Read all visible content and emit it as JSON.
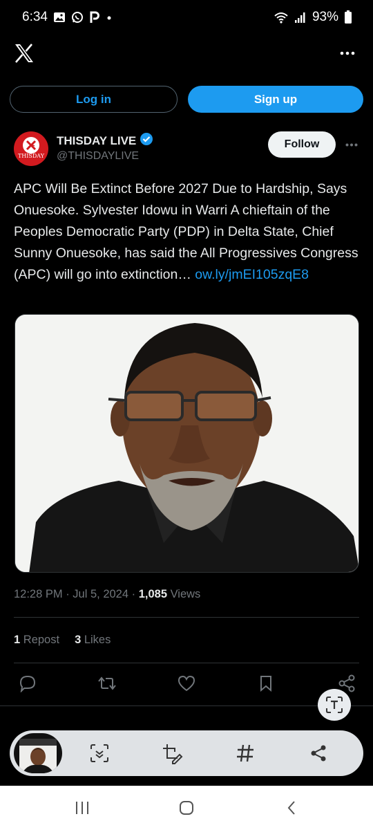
{
  "status_bar": {
    "time": "6:34",
    "battery": "93%",
    "notification_icons": [
      "gallery-icon",
      "whatsapp-icon",
      "p-app-icon",
      "dot-icon"
    ]
  },
  "auth": {
    "login_label": "Log in",
    "signup_label": "Sign up"
  },
  "tweet": {
    "author_name": "THISDAY LIVE",
    "author_handle": "@THISDAYLIVE",
    "avatar_text": "THISDAY",
    "follow_label": "Follow",
    "text": "APC Will Be Extinct Before 2027 Due to Hardship, Says Onuesoke. Sylvester Idowu in Warri A chieftain of the Peoples Democratic Party (PDP) in Delta State, Chief Sunny Onuesoke, has said the All Progressives Congress (APC) will go into extinction…",
    "link": "ow.ly/jmEI105zqE8",
    "time": "12:28 PM",
    "date": "Jul 5, 2024",
    "views_count": "1,085",
    "views_label": "Views",
    "repost_count": "1",
    "repost_label": "Repost",
    "likes_count": "3",
    "likes_label": "Likes"
  },
  "colors": {
    "background": "#000000",
    "accent": "#1d9bf0",
    "secondary_text": "#71767b",
    "divider": "#2f3336"
  }
}
